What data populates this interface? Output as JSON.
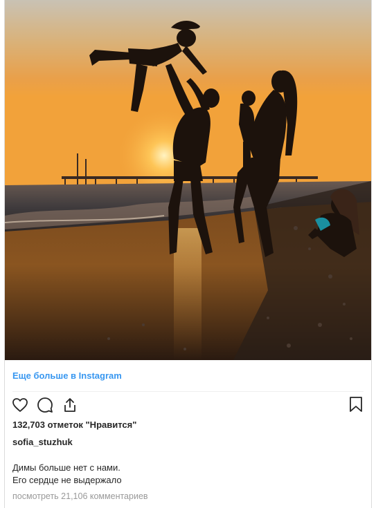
{
  "post": {
    "more_link": "Еще больше в Instagram",
    "likes": "132,703 отметок \"Нравится\"",
    "username": "sofia_stuzhuk",
    "caption_lines": [
      "Димы больше нет с нами.",
      "Его сердце не выдержало"
    ],
    "view_comments": "посмотреть 21,106 комментариев"
  },
  "icons": {
    "like": "heart-icon",
    "comment": "comment-icon",
    "share": "share-icon",
    "save": "bookmark-icon"
  },
  "colors": {
    "link": "#3897f0",
    "text": "#262626",
    "muted": "#999999",
    "divider": "#efefef"
  }
}
